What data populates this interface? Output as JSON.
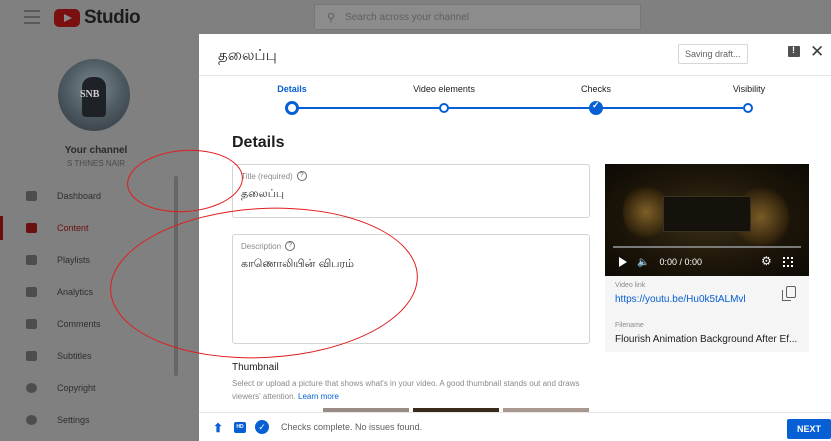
{
  "app": {
    "logo_text": "Studio",
    "search_placeholder": "Search across your channel"
  },
  "sidebar": {
    "your_channel": "Your channel",
    "channel_name": "S THINES NAIR",
    "items": [
      {
        "label": "Dashboard",
        "icon": "dashboard-icon"
      },
      {
        "label": "Content",
        "icon": "content-icon",
        "active": true
      },
      {
        "label": "Playlists",
        "icon": "playlists-icon"
      },
      {
        "label": "Analytics",
        "icon": "analytics-icon"
      },
      {
        "label": "Comments",
        "icon": "comments-icon"
      },
      {
        "label": "Subtitles",
        "icon": "subtitles-icon"
      },
      {
        "label": "Copyright",
        "icon": "copyright-icon"
      },
      {
        "label": "Settings",
        "icon": "settings-icon"
      }
    ]
  },
  "modal": {
    "title": "தலைப்பு",
    "saving_label": "Saving draft...",
    "steps": [
      {
        "label": "Details",
        "state": "current"
      },
      {
        "label": "Video elements",
        "state": "pending"
      },
      {
        "label": "Checks",
        "state": "done"
      },
      {
        "label": "Visibility",
        "state": "pending"
      }
    ],
    "section_title": "Details",
    "title_field": {
      "label": "Title (required)",
      "value": "தலைப்பு"
    },
    "description_field": {
      "label": "Description",
      "value": "காணொலியின் விபரம்"
    },
    "thumbnail": {
      "title": "Thumbnail",
      "description": "Select or upload a picture that shows what's in your video. A good thumbnail stands out and draws viewers' attention.",
      "learn_more": "Learn more"
    },
    "video": {
      "time": "0:00 / 0:00",
      "link_label": "Video link",
      "link": "https://youtu.be/Hu0k5tALMvl",
      "filename_label": "Filename",
      "filename": "Flourish Animation Background After Ef..."
    },
    "footer": {
      "status": "Checks complete. No issues found.",
      "hd_badge": "HD",
      "next_label": "NEXT"
    }
  },
  "colors": {
    "accent": "#065fd4",
    "annotation": "#e21b1b"
  }
}
